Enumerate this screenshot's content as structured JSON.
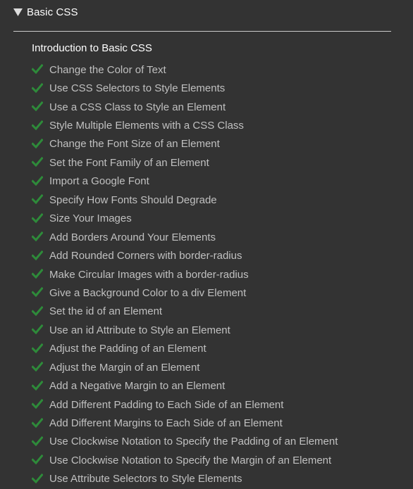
{
  "section": {
    "title": "Basic CSS",
    "caret_icon": "triangle-down-icon"
  },
  "intro": {
    "label": "Introduction to Basic CSS"
  },
  "colors": {
    "background": "#333333",
    "check": "#2e8b3a",
    "completed_text": "#c0c0c0",
    "title_text": "#ffffff"
  },
  "lessons": [
    {
      "label": "Change the Color of Text",
      "completed": true
    },
    {
      "label": "Use CSS Selectors to Style Elements",
      "completed": true
    },
    {
      "label": "Use a CSS Class to Style an Element",
      "completed": true
    },
    {
      "label": "Style Multiple Elements with a CSS Class",
      "completed": true
    },
    {
      "label": "Change the Font Size of an Element",
      "completed": true
    },
    {
      "label": "Set the Font Family of an Element",
      "completed": true
    },
    {
      "label": "Import a Google Font",
      "completed": true
    },
    {
      "label": "Specify How Fonts Should Degrade",
      "completed": true
    },
    {
      "label": "Size Your Images",
      "completed": true
    },
    {
      "label": "Add Borders Around Your Elements",
      "completed": true
    },
    {
      "label": "Add Rounded Corners with border-radius",
      "completed": true
    },
    {
      "label": "Make Circular Images with a border-radius",
      "completed": true
    },
    {
      "label": "Give a Background Color to a div Element",
      "completed": true
    },
    {
      "label": "Set the id of an Element",
      "completed": true
    },
    {
      "label": "Use an id Attribute to Style an Element",
      "completed": true
    },
    {
      "label": "Adjust the Padding of an Element",
      "completed": true
    },
    {
      "label": "Adjust the Margin of an Element",
      "completed": true
    },
    {
      "label": "Add a Negative Margin to an Element",
      "completed": true
    },
    {
      "label": "Add Different Padding to Each Side of an Element",
      "completed": true
    },
    {
      "label": "Add Different Margins to Each Side of an Element",
      "completed": true
    },
    {
      "label": "Use Clockwise Notation to Specify the Padding of an Element",
      "completed": true
    },
    {
      "label": "Use Clockwise Notation to Specify the Margin of an Element",
      "completed": true
    },
    {
      "label": "Use Attribute Selectors to Style Elements",
      "completed": true
    }
  ]
}
